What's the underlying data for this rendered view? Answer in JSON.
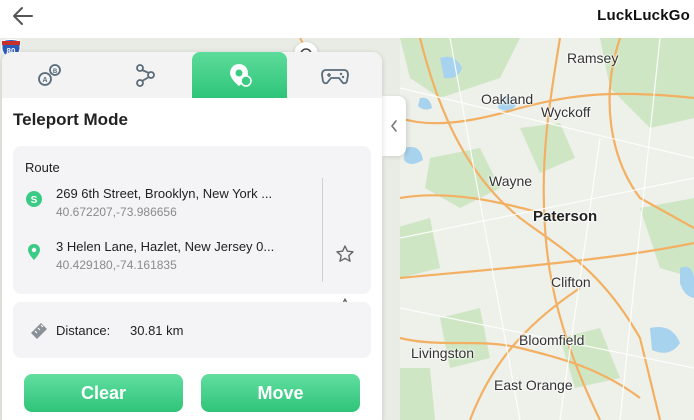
{
  "app": {
    "brand": "LuckLuckGo"
  },
  "tabs": [
    {
      "icon": "ab-route-icon"
    },
    {
      "icon": "multi-stop-route-icon"
    },
    {
      "icon": "teleport-icon"
    },
    {
      "icon": "joystick-icon"
    }
  ],
  "active_tab": 2,
  "panel": {
    "title": "Teleport Mode",
    "route_label": "Route",
    "start": {
      "address": "269 6th Street, Brooklyn, New York ...",
      "coords": "40.672207,-73.986656",
      "badge": "S"
    },
    "end": {
      "address": "3 Helen Lane, Hazlet, New Jersey 0...",
      "coords": "40.429180,-74.161835"
    },
    "distance_label": "Distance:",
    "distance_value": "30.81 km",
    "clear_label": "Clear",
    "move_label": "Move"
  },
  "map": {
    "labels": [
      "Ramsey",
      "Oakland",
      "Wyckoff",
      "Wayne",
      "Paterson",
      "Clifton",
      "Livingston",
      "Bloomfield",
      "East Orange"
    ],
    "shield_number": "80"
  },
  "colors": {
    "accent": "#3ccb85",
    "road": "#f3b063",
    "green": "#c9e4c0",
    "water": "#a8d3ee"
  }
}
